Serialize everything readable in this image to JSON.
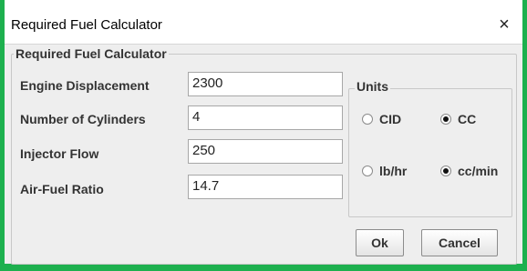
{
  "window": {
    "title": "Required Fuel Calculator",
    "close_icon": "×"
  },
  "main_group": {
    "title": "Required Fuel Calculator"
  },
  "fields": [
    {
      "label": "Engine Displacement",
      "value": "2300"
    },
    {
      "label": "Number of Cylinders",
      "value": "4"
    },
    {
      "label": "Injector Flow",
      "value": "250"
    },
    {
      "label": "Air-Fuel Ratio",
      "value": "14.7"
    }
  ],
  "units": {
    "title": "Units",
    "options": [
      {
        "label": "CID",
        "selected": false
      },
      {
        "label": "CC",
        "selected": true
      },
      {
        "label": "lb/hr",
        "selected": false
      },
      {
        "label": "cc/min",
        "selected": true
      }
    ]
  },
  "buttons": {
    "ok": "Ok",
    "cancel": "Cancel"
  },
  "colors": {
    "frame": "#1db04e",
    "panel": "#eeeeee"
  }
}
